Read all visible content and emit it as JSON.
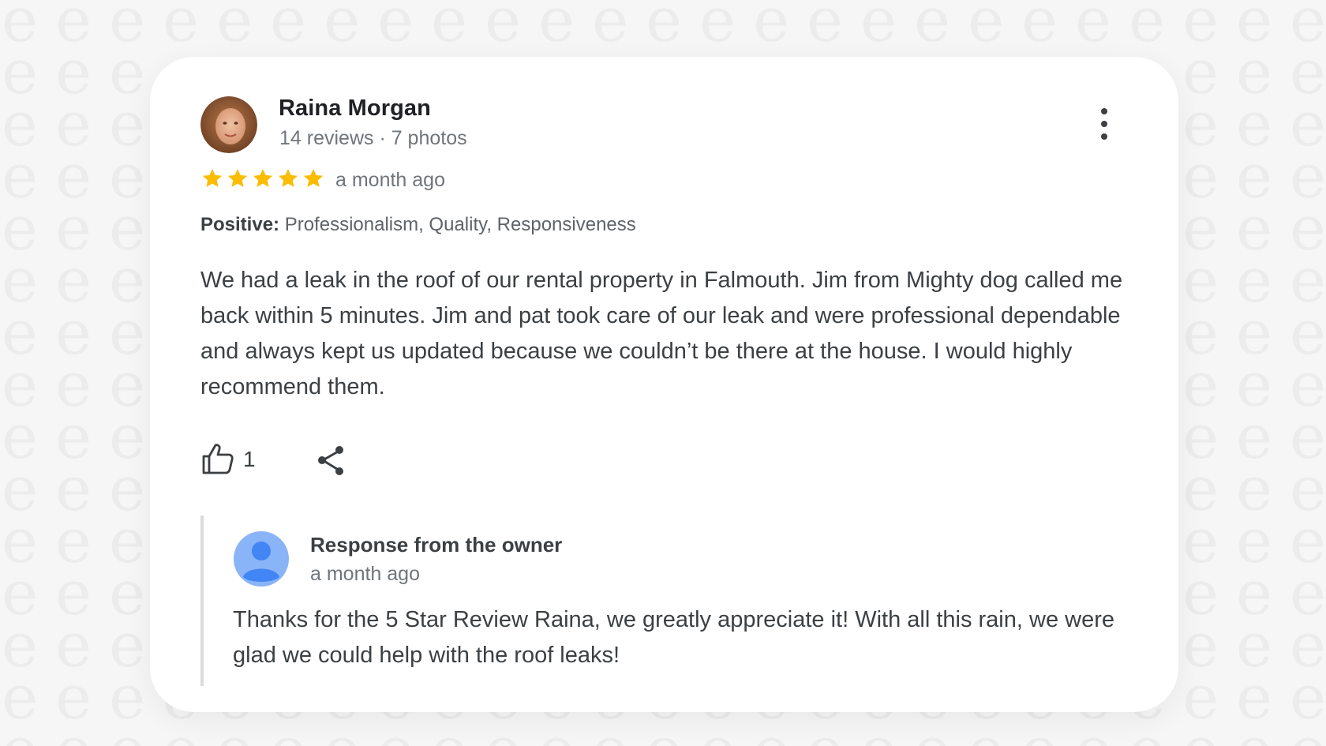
{
  "review": {
    "reviewer_name": "Raina Morgan",
    "reviewer_meta": "14 reviews · 7 photos",
    "rating": 5,
    "rating_max": 5,
    "time": "a month ago",
    "positive_label": "Positive:",
    "positive_values": "Professionalism, Quality, Responsiveness",
    "text": "We had a leak in the roof of our rental property in Falmouth. Jim from Mighty dog called me back within 5 minutes. Jim and pat took care of our leak and were professional dependable and always kept us updated because we couldn’t be there at the house. I would highly recommend them.",
    "like_count": "1"
  },
  "response": {
    "title": "Response from the owner",
    "time": "a month ago",
    "text": "Thanks for the 5 Star Review Raina, we greatly appreciate it! With all this rain, we were glad we could help with the roof leaks!"
  },
  "icons": {
    "more": "more-vert-icon",
    "star": "star-icon",
    "like": "thumbs-up-icon",
    "share": "share-icon",
    "owner_avatar": "default-user-icon"
  },
  "colors": {
    "star": "#fbbc04",
    "owner_avatar": "#8ab4f8",
    "owner_avatar_figure": "#4285f4",
    "response_bar": "#dadce0"
  }
}
